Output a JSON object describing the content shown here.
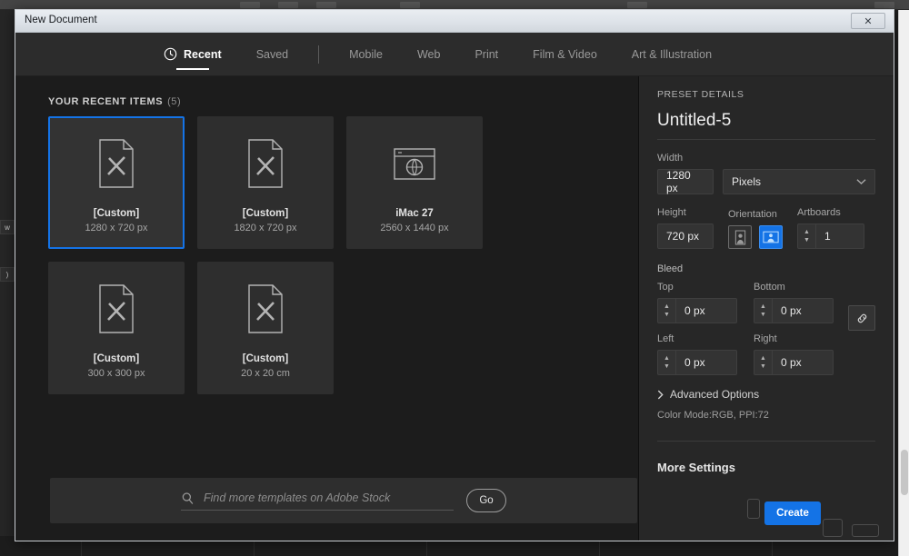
{
  "window": {
    "title": "New Document",
    "close_label": "✕"
  },
  "tabs": [
    {
      "label": "Recent",
      "icon": "clock-icon",
      "active": true
    },
    {
      "label": "Saved",
      "icon": "",
      "active": false
    },
    {
      "label": "Mobile",
      "icon": "",
      "active": false
    },
    {
      "label": "Web",
      "icon": "",
      "active": false
    },
    {
      "label": "Print",
      "icon": "",
      "active": false
    },
    {
      "label": "Film & Video",
      "icon": "",
      "active": false
    },
    {
      "label": "Art & Illustration",
      "icon": "",
      "active": false
    }
  ],
  "recent": {
    "heading": "YOUR RECENT ITEMS",
    "count": "(5)",
    "items": [
      {
        "title": "[Custom]",
        "size": "1280 x 720 px",
        "icon": "document-art-icon",
        "selected": true
      },
      {
        "title": "[Custom]",
        "size": "1820 x 720 px",
        "icon": "document-art-icon",
        "selected": false
      },
      {
        "title": "iMac 27",
        "size": "2560 x 1440 px",
        "icon": "browser-globe-icon",
        "selected": false
      },
      {
        "title": "[Custom]",
        "size": "300 x 300 px",
        "icon": "document-art-icon",
        "selected": false
      },
      {
        "title": "[Custom]",
        "size": "20 x 20 cm",
        "icon": "document-art-icon",
        "selected": false
      }
    ]
  },
  "stock": {
    "placeholder": "Find more templates on Adobe Stock",
    "value": "",
    "go_label": "Go",
    "search_icon": "search-icon"
  },
  "preset": {
    "heading": "PRESET DETAILS",
    "name": "Untitled-5",
    "width_label": "Width",
    "width_value": "1280 px",
    "units_value": "Pixels",
    "units_caret": "chevron-down-icon",
    "height_label": "Height",
    "height_value": "720 px",
    "orientation_label": "Orientation",
    "orientation_portrait": "portrait-icon",
    "orientation_landscape": "landscape-icon",
    "orientation_active": "landscape",
    "artboards_label": "Artboards",
    "artboards_value": "1",
    "bleed_label": "Bleed",
    "bleed": [
      {
        "label": "Top",
        "value": "0 px"
      },
      {
        "label": "Bottom",
        "value": "0 px"
      },
      {
        "label": "Left",
        "value": "0 px"
      },
      {
        "label": "Right",
        "value": "0 px"
      }
    ],
    "link_icon": "link-chain-icon",
    "advanced_label": "Advanced Options",
    "advanced_caret": "chevron-right-icon",
    "color_mode": "Color Mode:RGB, PPI:72",
    "more_settings": "More Settings"
  },
  "actions": {
    "create_label": "Create"
  },
  "colors": {
    "accent": "#1473e6",
    "dialog_bg": "#1e1e1e",
    "panel_bg": "#272727",
    "card_bg": "#2e2e2e",
    "titlebar": "#e2e7ec"
  }
}
